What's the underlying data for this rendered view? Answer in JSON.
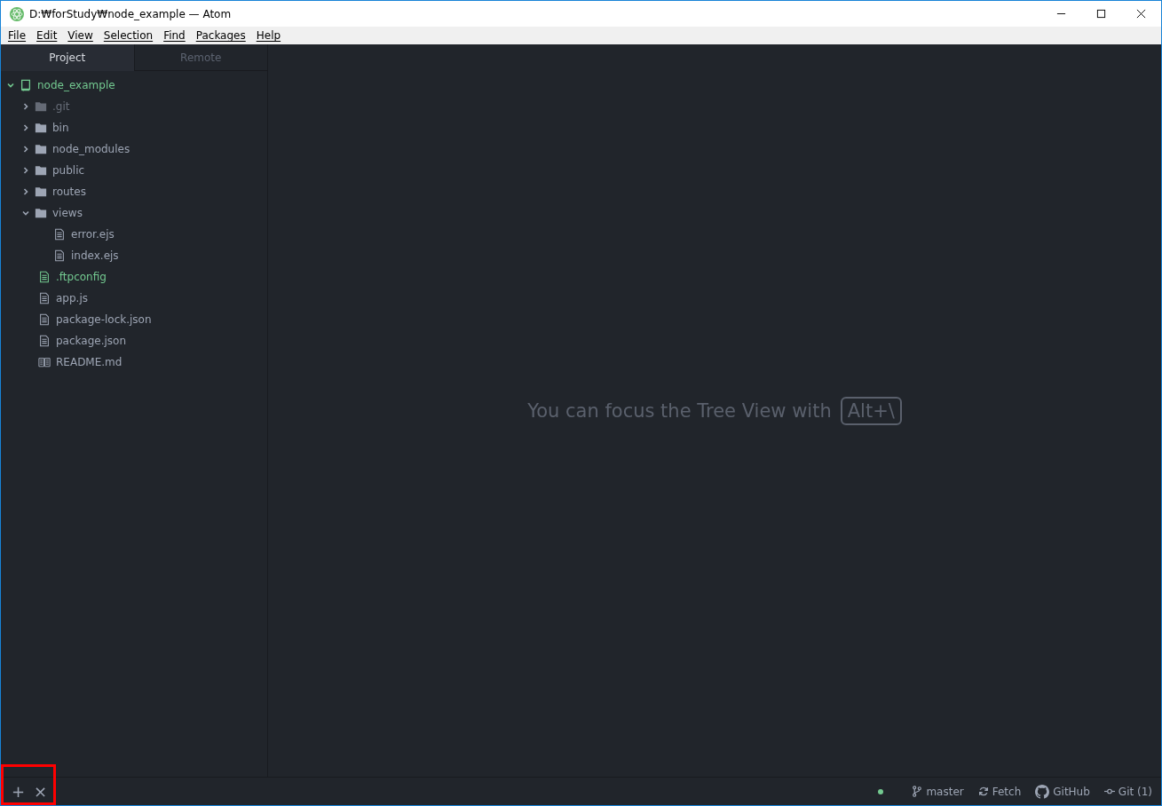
{
  "window": {
    "title": "D:₩forStudy₩node_example — Atom"
  },
  "menu": [
    "File",
    "Edit",
    "View",
    "Selection",
    "Find",
    "Packages",
    "Help"
  ],
  "panel_tabs": [
    {
      "label": "Project",
      "selected": true
    },
    {
      "label": "Remote",
      "selected": false
    }
  ],
  "tree": [
    {
      "name": "node_example",
      "kind": "project",
      "expanded": true,
      "added": true,
      "ignored": false,
      "children": [
        {
          "name": ".git",
          "kind": "folder",
          "expanded": false,
          "added": false,
          "ignored": true
        },
        {
          "name": "bin",
          "kind": "folder",
          "expanded": false,
          "added": false,
          "ignored": false
        },
        {
          "name": "node_modules",
          "kind": "folder",
          "expanded": false,
          "added": false,
          "ignored": false
        },
        {
          "name": "public",
          "kind": "folder",
          "expanded": false,
          "added": false,
          "ignored": false
        },
        {
          "name": "routes",
          "kind": "folder",
          "expanded": false,
          "added": false,
          "ignored": false
        },
        {
          "name": "views",
          "kind": "folder",
          "expanded": true,
          "added": false,
          "ignored": false,
          "children": [
            {
              "name": "error.ejs",
              "kind": "file",
              "added": false,
              "ignored": false
            },
            {
              "name": "index.ejs",
              "kind": "file",
              "added": false,
              "ignored": false
            }
          ]
        },
        {
          "name": ".ftpconfig",
          "kind": "file",
          "added": true,
          "ignored": false
        },
        {
          "name": "app.js",
          "kind": "file",
          "added": false,
          "ignored": false
        },
        {
          "name": "package-lock.json",
          "kind": "file",
          "added": false,
          "ignored": false
        },
        {
          "name": "package.json",
          "kind": "file",
          "added": false,
          "ignored": false
        },
        {
          "name": "README.md",
          "kind": "readme",
          "added": false,
          "ignored": false
        }
      ]
    }
  ],
  "editor_hint": {
    "text": "You can focus the Tree View with",
    "key": "Alt+\\"
  },
  "dock_buttons": [
    "+",
    "×"
  ],
  "status_bar": {
    "branch": "master",
    "fetch": "Fetch",
    "github": "GitHub",
    "git": "Git (1)"
  }
}
